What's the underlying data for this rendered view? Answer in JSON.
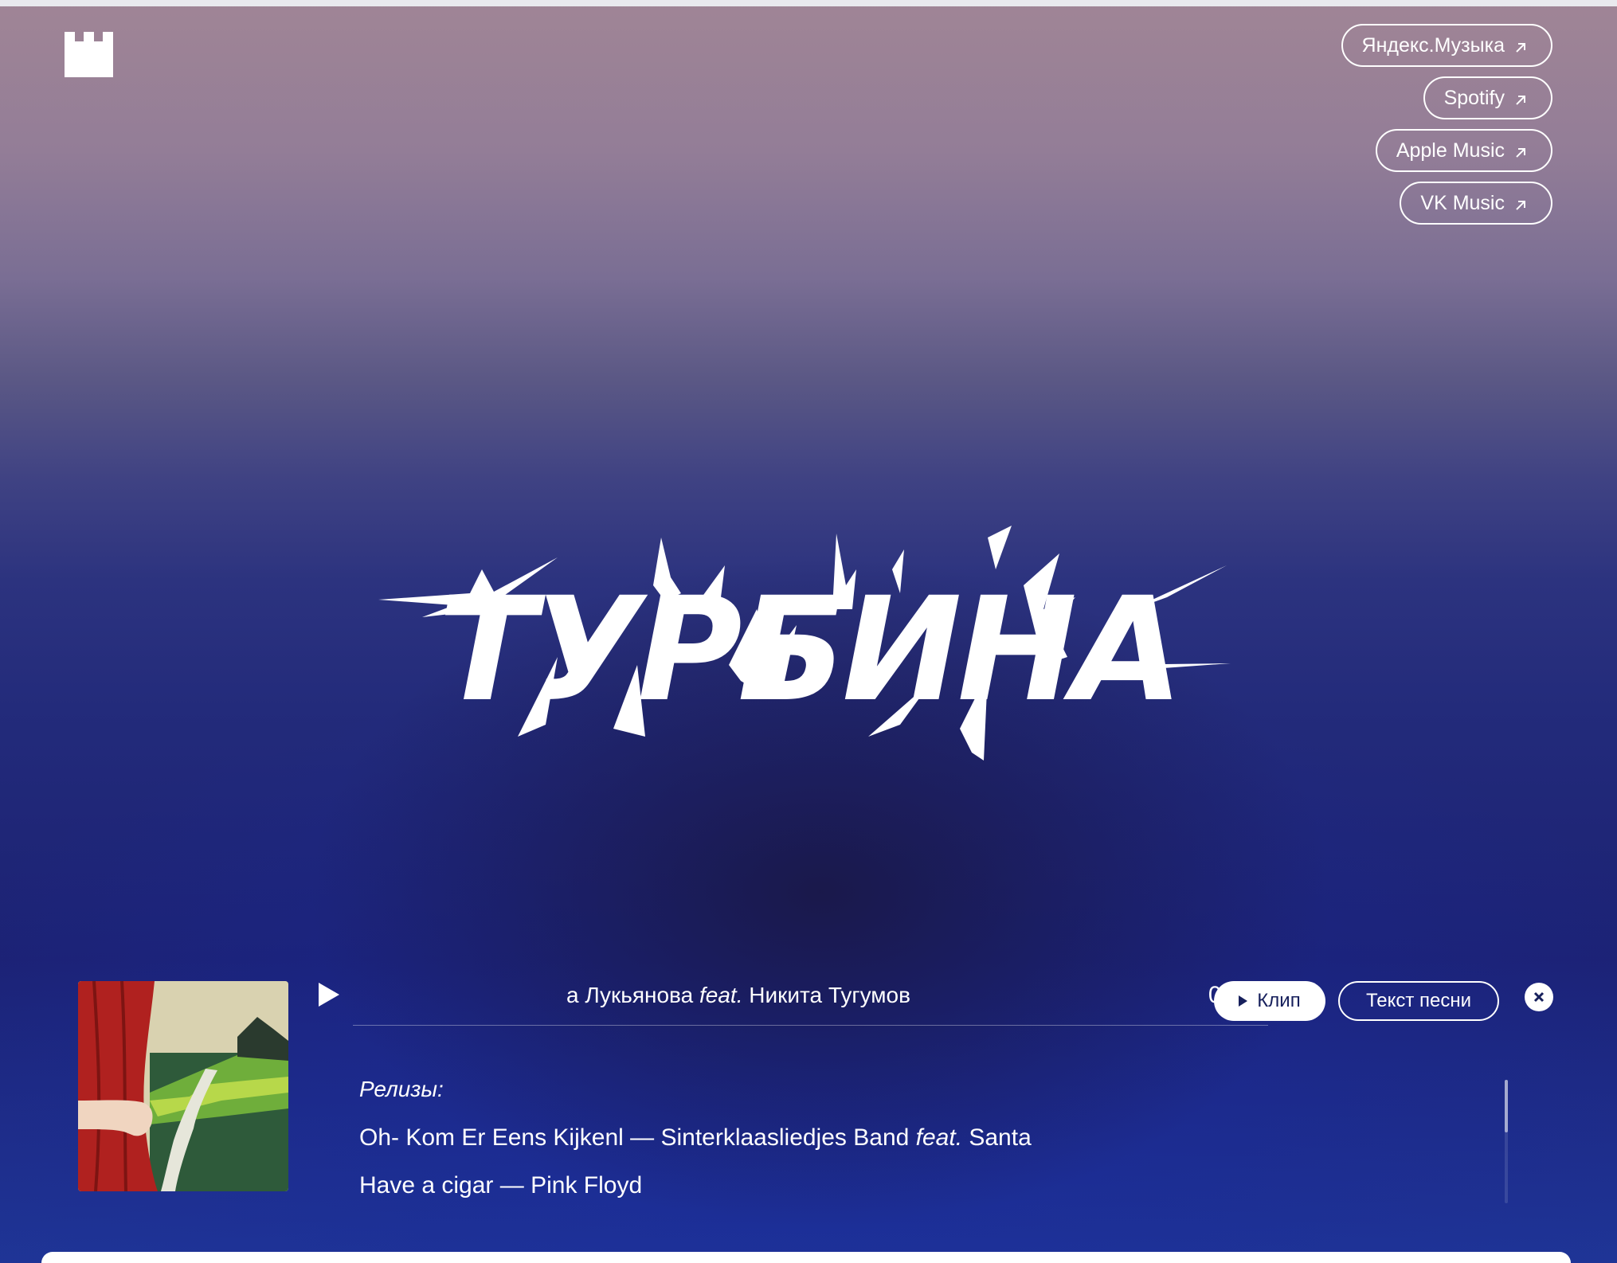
{
  "header": {
    "logo_icon": "castle-tower-icon",
    "platforms": [
      {
        "label": "Яндекс.Музыка",
        "icon": "external-arrow-icon"
      },
      {
        "label": "Spotify",
        "icon": "external-arrow-icon"
      },
      {
        "label": "Apple Music",
        "icon": "external-arrow-icon"
      },
      {
        "label": "VK Music",
        "icon": "external-arrow-icon"
      }
    ]
  },
  "hero": {
    "title": "ТУРБИНА"
  },
  "player": {
    "track_artist_left": "а Лукьянова ",
    "track_feat": "feat.",
    "track_artist_right": " Никита Тугумов",
    "duration": "02:50",
    "clip_label": "Клип",
    "lyrics_label": "Текст песни",
    "releases_label": "Релизы:",
    "releases": [
      {
        "title": "Oh- Kom Er Eens Kijkenl — Sinterklaasliedjes Band ",
        "feat": "feat.",
        "rest": " Santa"
      },
      {
        "title": "Have a cigar — Pink Floyd",
        "feat": "",
        "rest": ""
      }
    ]
  },
  "colors": {
    "accent_dark": "#17205c",
    "background_top": "#a08596",
    "background_bottom": "#1f3596"
  }
}
